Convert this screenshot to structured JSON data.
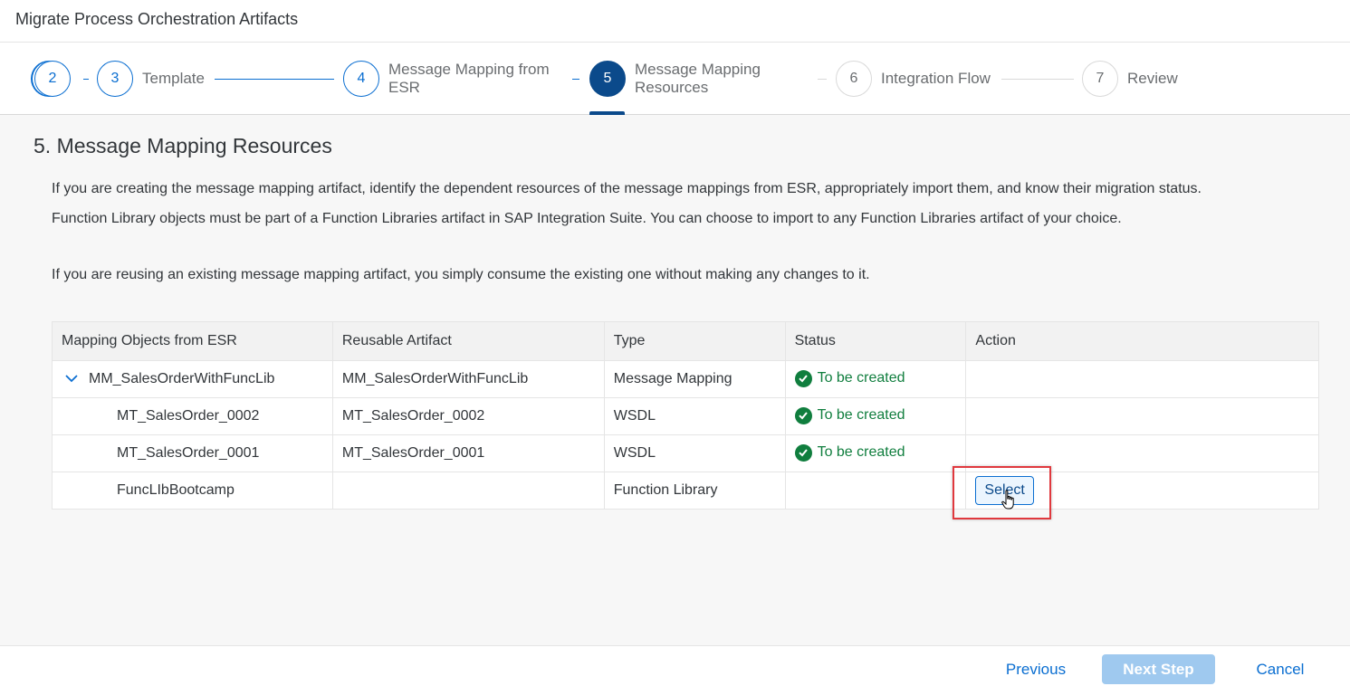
{
  "dialog": {
    "title": "Migrate Process Orchestration Artifacts"
  },
  "wizard": {
    "steps": [
      {
        "number": "2",
        "label": ""
      },
      {
        "number": "3",
        "label": "Template"
      },
      {
        "number": "4",
        "label_line1": "Message Mapping from",
        "label_line2": "ESR"
      },
      {
        "number": "5",
        "label_line1": "Message Mapping",
        "label_line2": "Resources"
      },
      {
        "number": "6",
        "label": "Integration Flow"
      },
      {
        "number": "7",
        "label": "Review"
      }
    ]
  },
  "section": {
    "title": "5. Message Mapping Resources",
    "para1": "If you are creating the message mapping artifact, identify the dependent resources of the message mappings from ESR, appropriately import them, and know their migration status.",
    "para2": "Function Library objects must be part of a Function Libraries artifact in SAP Integration Suite. You can choose to import to any Function Libraries artifact of your choice.",
    "para3": "If you are reusing an existing message mapping artifact, you simply consume the existing one without making any changes to it."
  },
  "table": {
    "headers": [
      "Mapping Objects from ESR",
      "Reusable Artifact",
      "Type",
      "Status",
      "Action"
    ],
    "rows": [
      {
        "object": "MM_SalesOrderWithFuncLib",
        "artifact": "MM_SalesOrderWithFuncLib",
        "type": "Message Mapping",
        "status": "To be created",
        "action": ""
      },
      {
        "object": "MT_SalesOrder_0002",
        "artifact": "MT_SalesOrder_0002",
        "type": "WSDL",
        "status": "To be created",
        "action": ""
      },
      {
        "object": "MT_SalesOrder_0001",
        "artifact": "MT_SalesOrder_0001",
        "type": "WSDL",
        "status": "To be created",
        "action": ""
      },
      {
        "object": "FuncLIbBootcamp",
        "artifact": "",
        "type": "Function Library",
        "status": "",
        "action": "Select"
      }
    ]
  },
  "footer": {
    "previous": "Previous",
    "next": "Next Step",
    "cancel": "Cancel"
  },
  "colors": {
    "accent": "#0a6ed1",
    "active_step": "#0b4a8b",
    "success": "#107e3e",
    "highlight": "#e0393e",
    "next_disabled": "#9fc9ef"
  },
  "icons": {
    "expand": "chevron-down-icon",
    "status": "check-circle-icon",
    "pointer": "hand-cursor-icon"
  }
}
